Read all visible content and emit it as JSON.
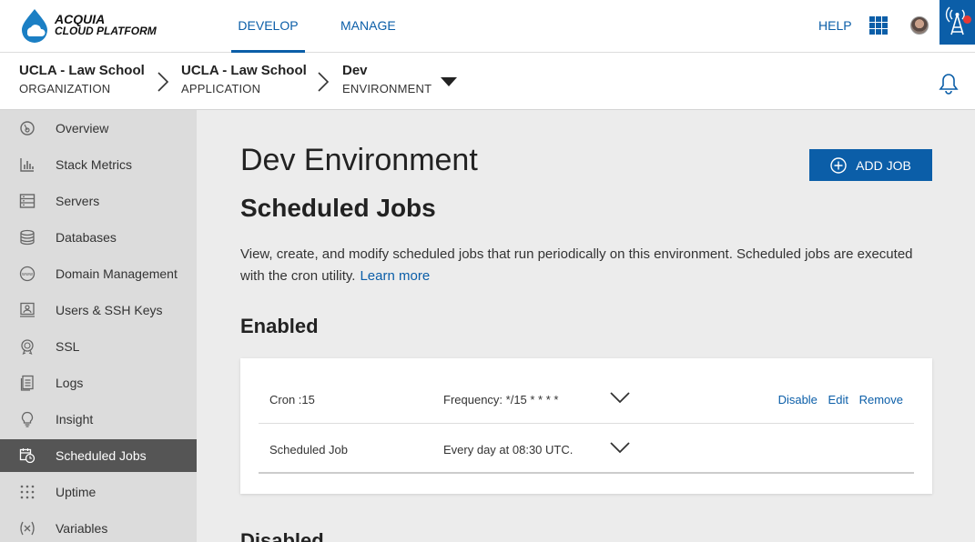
{
  "brand": {
    "line1": "ACQUIA",
    "line2": "CLOUD PLATFORM",
    "color": "#0b5ea8"
  },
  "nav": {
    "tabs": [
      {
        "label": "DEVELOP",
        "active": true
      },
      {
        "label": "MANAGE",
        "active": false
      }
    ],
    "help": "HELP"
  },
  "breadcrumb": [
    {
      "name": "UCLA - Law School",
      "type": "ORGANIZATION"
    },
    {
      "name": "UCLA - Law School",
      "type": "APPLICATION"
    },
    {
      "name": "Dev",
      "type": "ENVIRONMENT"
    }
  ],
  "sidebar": {
    "items": [
      {
        "label": "Overview",
        "icon": "overview-icon"
      },
      {
        "label": "Stack Metrics",
        "icon": "stack-metrics-icon"
      },
      {
        "label": "Servers",
        "icon": "servers-icon"
      },
      {
        "label": "Databases",
        "icon": "databases-icon"
      },
      {
        "label": "Domain Management",
        "icon": "www-icon"
      },
      {
        "label": "Users & SSH Keys",
        "icon": "users-icon"
      },
      {
        "label": "SSL",
        "icon": "ssl-icon"
      },
      {
        "label": "Logs",
        "icon": "logs-icon"
      },
      {
        "label": "Insight",
        "icon": "lightbulb-icon"
      },
      {
        "label": "Scheduled Jobs",
        "icon": "scheduled-jobs-icon",
        "active": true
      },
      {
        "label": "Uptime",
        "icon": "uptime-icon"
      },
      {
        "label": "Variables",
        "icon": "variables-icon"
      }
    ]
  },
  "main": {
    "title": "Dev Environment",
    "add_job_label": "ADD JOB",
    "subtitle": "Scheduled Jobs",
    "description": "View, create, and modify scheduled jobs that run periodically on this environment. Scheduled jobs are executed with the cron utility.",
    "learn_more": "Learn more",
    "enabled_heading": "Enabled",
    "disabled_heading": "Disabled",
    "jobs": [
      {
        "name": "Cron :15",
        "frequency": "Frequency: */15 * * * *",
        "actions": {
          "disable": "Disable",
          "edit": "Edit",
          "remove": "Remove"
        }
      },
      {
        "name": "Scheduled Job",
        "frequency": "Every day at 08:30 UTC."
      }
    ]
  }
}
